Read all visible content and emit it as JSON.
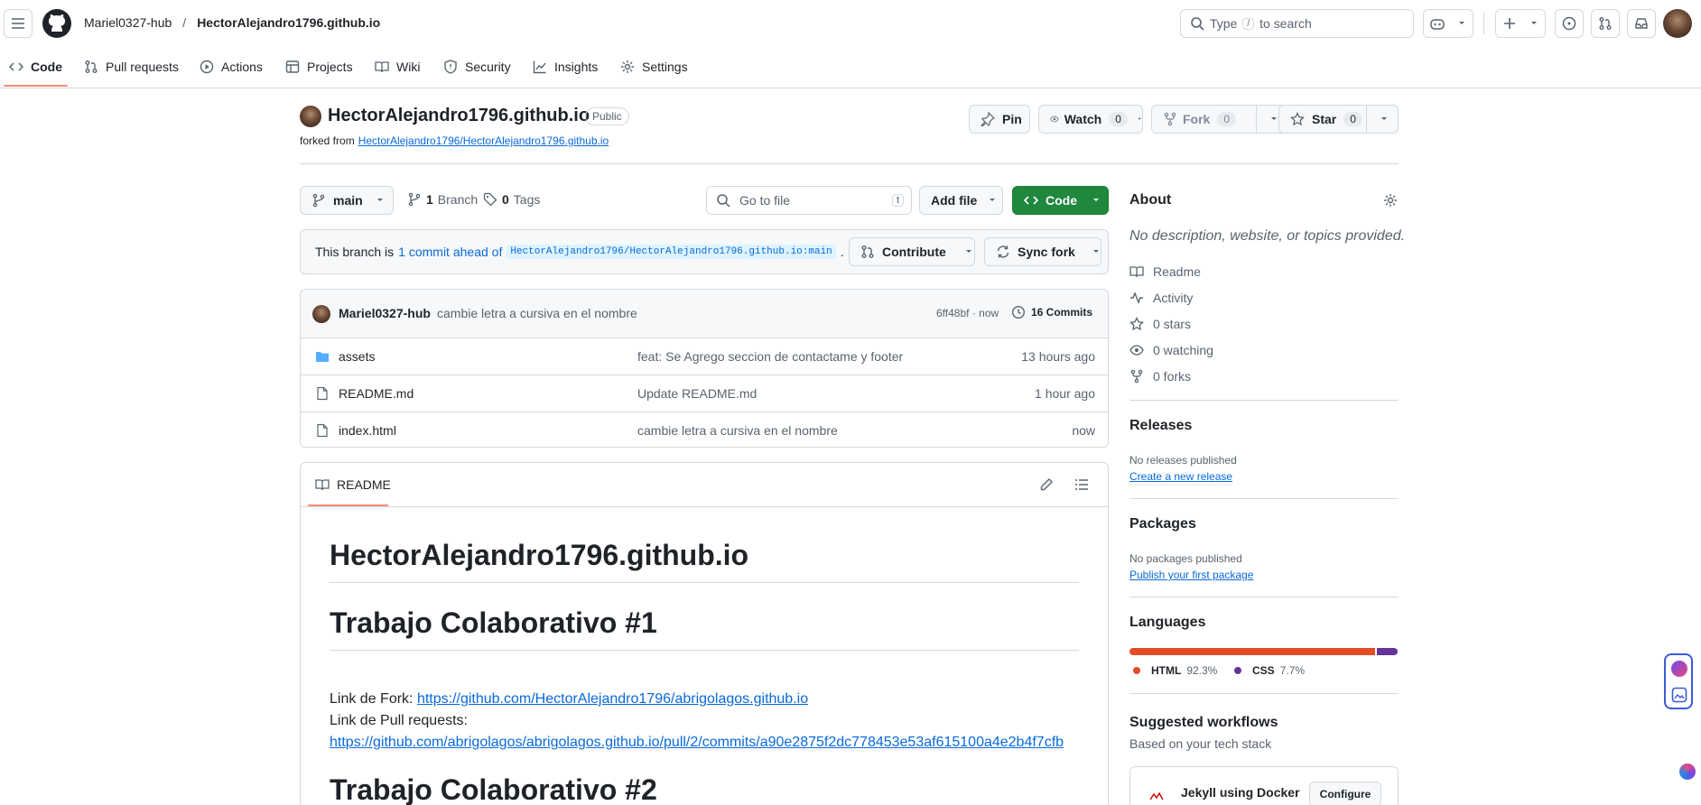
{
  "header": {
    "owner": "Mariel0327-hub",
    "separator": "/",
    "repo": "HectorAlejandro1796.github.io",
    "search_type": "Type",
    "search_key": "/",
    "search_rest": "to search"
  },
  "nav_tabs": [
    {
      "label": "Code",
      "icon": "code-icon"
    },
    {
      "label": "Pull requests",
      "icon": "pull-request-icon"
    },
    {
      "label": "Actions",
      "icon": "play-icon"
    },
    {
      "label": "Projects",
      "icon": "table-icon"
    },
    {
      "label": "Wiki",
      "icon": "book-icon"
    },
    {
      "label": "Security",
      "icon": "shield-icon"
    },
    {
      "label": "Insights",
      "icon": "graph-icon"
    },
    {
      "label": "Settings",
      "icon": "gear-icon"
    }
  ],
  "repo": {
    "name": "HectorAlejandro1796.github.io",
    "visibility": "Public",
    "forked_from_label": "forked from",
    "forked_from_link": "HectorAlejandro1796/HectorAlejandro1796.github.io",
    "pin_label": "Pin",
    "watch_label": "Watch",
    "watch_count": "0",
    "fork_label": "Fork",
    "fork_count": "0",
    "star_label": "Star",
    "star_count": "0"
  },
  "toolbar": {
    "branch": "main",
    "branch_count": "1",
    "branch_label": "Branch",
    "tag_count": "0",
    "tag_label": "Tags",
    "goto_placeholder": "Go to file",
    "goto_key": "t",
    "add_file_label": "Add file",
    "code_label": "Code"
  },
  "branch_status": {
    "prefix": "This branch is",
    "link": "1 commit ahead of",
    "ref": "HectorAlejandro1796/HectorAlejandro1796.github.io:main",
    "suffix": ".",
    "contribute_label": "Contribute",
    "sync_label": "Sync fork"
  },
  "latest_commit": {
    "author": "Mariel0327-hub",
    "message": "cambie letra a cursiva en el nombre",
    "hash_time": "6ff48bf · now",
    "commits_label": "16 Commits"
  },
  "files": [
    {
      "name": "assets",
      "type": "folder",
      "message": "feat: Se Agrego seccion de contactame y footer",
      "time": "13 hours ago"
    },
    {
      "name": "README.md",
      "type": "file",
      "message": "Update README.md",
      "time": "1 hour ago"
    },
    {
      "name": "index.html",
      "type": "file",
      "message": "cambie letra a cursiva en el nombre",
      "time": "now"
    }
  ],
  "readme": {
    "tab_label": "README",
    "h1": "HectorAlejandro1796.github.io",
    "h2a": "Trabajo Colaborativo #1",
    "fork_label": "Link de Fork:",
    "fork_url": "https://github.com/HectorAlejandro1796/abrigolagos.github.io",
    "pr_label": "Link de Pull requests:",
    "pr_url": "https://github.com/abrigolagos/abrigolagos.github.io/pull/2/commits/a90e2875f2dc778453e53af615100a4e2b4f7cfb",
    "h2b": "Trabajo Colaborativo #2"
  },
  "about": {
    "title": "About",
    "description": "No description, website, or topics provided.",
    "items": [
      {
        "label": "Readme",
        "icon": "book-icon"
      },
      {
        "label": "Activity",
        "icon": "pulse-icon"
      },
      {
        "label": "0 stars",
        "icon": "star-icon"
      },
      {
        "label": "0 watching",
        "icon": "eye-icon"
      },
      {
        "label": "0 forks",
        "icon": "fork-icon"
      }
    ]
  },
  "releases": {
    "title": "Releases",
    "empty": "No releases published",
    "link": "Create a new release"
  },
  "packages": {
    "title": "Packages",
    "empty": "No packages published",
    "link": "Publish your first package"
  },
  "languages": {
    "title": "Languages",
    "items": [
      {
        "name": "HTML",
        "percent": "92.3%",
        "value": 92.3,
        "color": "#e34c26"
      },
      {
        "name": "CSS",
        "percent": "7.7%",
        "value": 7.7,
        "color": "#663399"
      }
    ]
  },
  "workflows": {
    "title": "Suggested workflows",
    "subtitle": "Based on your tech stack",
    "item": "Jekyll using Docker",
    "configure_label": "Configure"
  }
}
